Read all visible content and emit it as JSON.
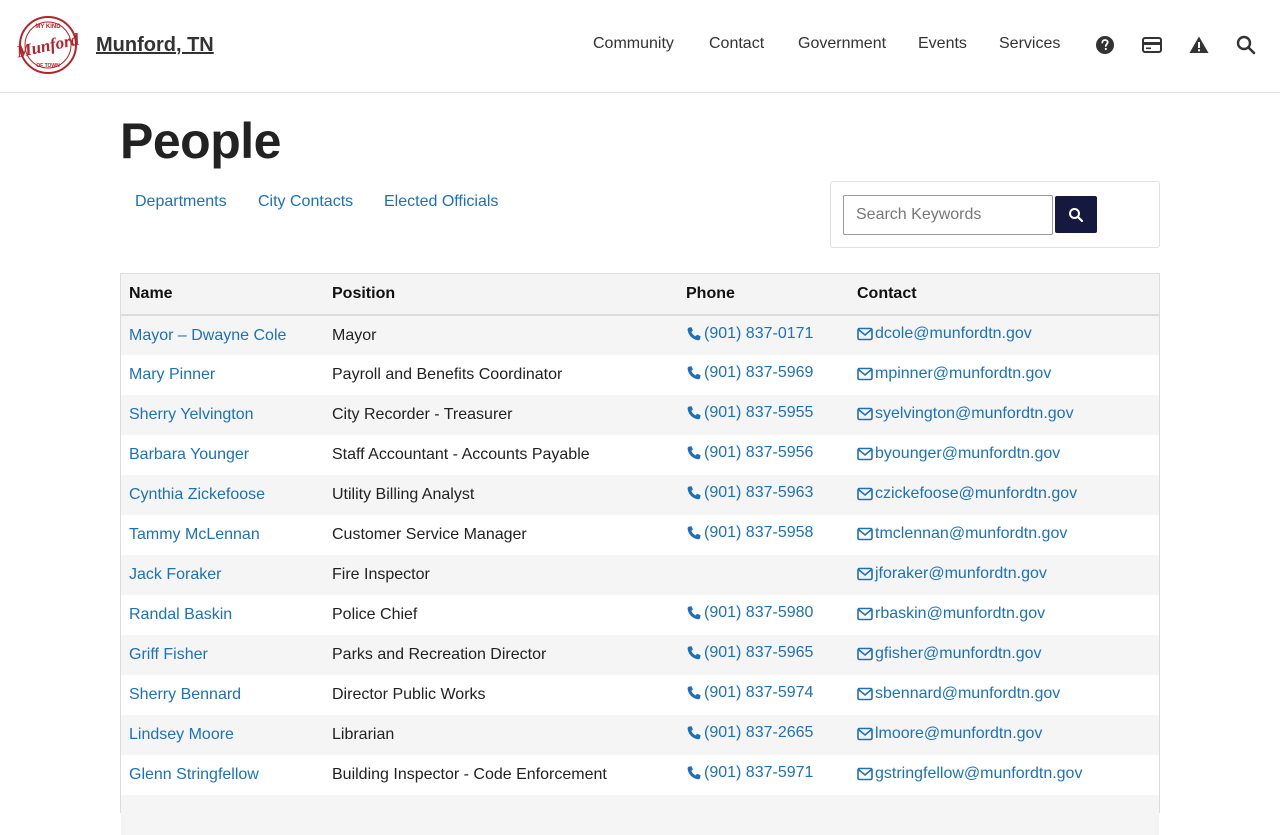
{
  "site": {
    "name": "Munford, TN",
    "logo_text": "Munford",
    "logo_ring_top": "MY KIND",
    "logo_ring_bottom": "OF TOWN"
  },
  "nav": {
    "items": [
      "Community",
      "Contact",
      "Government",
      "Events",
      "Services"
    ]
  },
  "tools": {
    "help_icon": "question-circle-icon",
    "pay_icon": "credit-card-icon",
    "alert_icon": "warning-triangle-icon",
    "search_icon": "search-icon"
  },
  "page": {
    "title": "People"
  },
  "subnav": {
    "items": [
      "Departments",
      "City Contacts",
      "Elected Officials"
    ]
  },
  "search": {
    "placeholder": "Search Keywords",
    "button_icon": "search-icon"
  },
  "table": {
    "headers": [
      "Name",
      "Position",
      "Phone",
      "Contact"
    ],
    "rows": [
      {
        "name": "Mayor – Dwayne Cole",
        "position": "Mayor",
        "phone": "(901) 837-0171",
        "email": "dcole@munfordtn.gov"
      },
      {
        "name": "Mary Pinner",
        "position": "Payroll and Benefits Coordinator",
        "phone": "(901) 837-5969",
        "email": "mpinner@munfordtn.gov"
      },
      {
        "name": "Sherry Yelvington",
        "position": "City Recorder - Treasurer",
        "phone": "(901) 837-5955",
        "email": "syelvington@munfordtn.gov"
      },
      {
        "name": "Barbara Younger",
        "position": "Staff Accountant - Accounts Payable",
        "phone": "(901) 837-5956",
        "email": "byounger@munfordtn.gov"
      },
      {
        "name": "Cynthia Zickefoose",
        "position": "Utility Billing Analyst",
        "phone": "(901) 837-5963",
        "email": "czickefoose@munfordtn.gov"
      },
      {
        "name": "Tammy McLennan",
        "position": "Customer Service Manager",
        "phone": "(901) 837-5958",
        "email": "tmclennan@munfordtn.gov"
      },
      {
        "name": "Jack Foraker",
        "position": "Fire Inspector",
        "phone": "",
        "email": "jforaker@munfordtn.gov"
      },
      {
        "name": "Randal Baskin",
        "position": "Police Chief",
        "phone": "(901) 837-5980",
        "email": "rbaskin@munfordtn.gov"
      },
      {
        "name": "Griff Fisher",
        "position": "Parks and Recreation Director",
        "phone": "(901) 837-5965",
        "email": "gfisher@munfordtn.gov"
      },
      {
        "name": "Sherry Bennard",
        "position": "Director Public Works",
        "phone": "(901) 837-5974",
        "email": "sbennard@munfordtn.gov"
      },
      {
        "name": "Lindsey Moore",
        "position": "Librarian",
        "phone": "(901) 837-2665",
        "email": "lmoore@munfordtn.gov"
      },
      {
        "name": "Glenn Stringfellow",
        "position": "Building Inspector - Code Enforcement",
        "phone": "(901) 837-5971",
        "email": "gstringfellow@munfordtn.gov"
      },
      {
        "name": "",
        "position": "",
        "phone": "",
        "email": ""
      }
    ],
    "phone_icon": "phone-icon",
    "email_icon": "envelope-icon"
  },
  "colors": {
    "link": "#1d71b8",
    "search_button": "#16193f",
    "logo_red": "#b3232b",
    "row_stripe": "#f5f5f5"
  }
}
